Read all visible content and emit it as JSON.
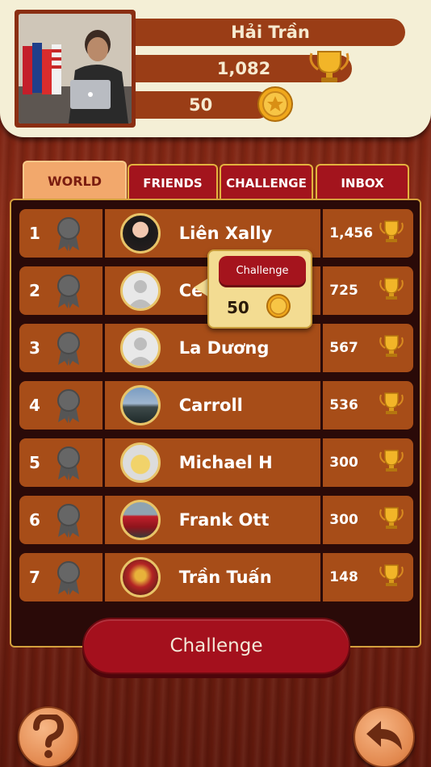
{
  "profile": {
    "name": "Hải Trần",
    "trophies": "1,082",
    "coins": "50"
  },
  "tabs": [
    {
      "label": "WORLD",
      "active": true
    },
    {
      "label": "FRIENDS",
      "active": false
    },
    {
      "label": "CHALLENGE",
      "active": false
    },
    {
      "label": "INBOX",
      "active": false
    }
  ],
  "leaderboard": [
    {
      "rank": "1",
      "name": "Liên Xally",
      "score": "1,456"
    },
    {
      "rank": "2",
      "name": "Ce",
      "score": "725"
    },
    {
      "rank": "3",
      "name": "La Dương",
      "score": "567"
    },
    {
      "rank": "4",
      "name": "Carroll",
      "score": "536"
    },
    {
      "rank": "5",
      "name": "Michael H",
      "score": "300"
    },
    {
      "rank": "6",
      "name": "Frank Ott",
      "score": "300"
    },
    {
      "rank": "7",
      "name": "Trần Tuấn",
      "score": "148"
    }
  ],
  "popup": {
    "button_label": "Challenge",
    "amount": "50"
  },
  "footer": {
    "challenge_label": "Challenge"
  },
  "colors": {
    "row_bg": "#a74d18",
    "tab_red": "#a3141d",
    "tab_active": "#f2a86c",
    "gold": "#e8c468"
  },
  "icons": {
    "rank_badge": "ribbon-icon",
    "score": "trophy-icon",
    "currency": "coin-icon",
    "help": "question-icon",
    "back": "back-arrow-icon"
  }
}
